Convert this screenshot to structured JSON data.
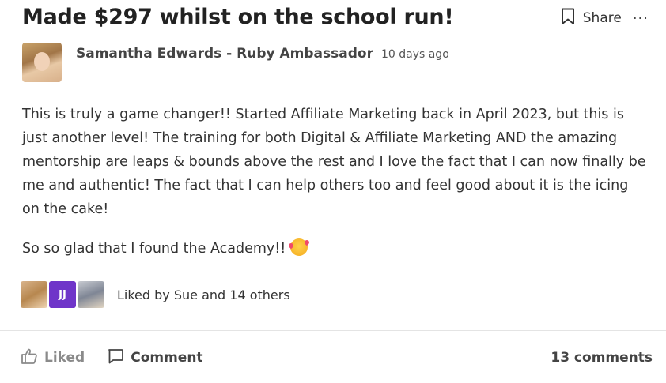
{
  "post": {
    "title": "Made $297 whilst on the school run!",
    "author": "Samantha Edwards - Ruby Ambassador",
    "time": "10 days ago",
    "paragraphs": [
      "This is truly a game changer!! Started Affiliate Marketing back in April 2023, but this is just another level! The training for both Digital & Affiliate Marketing AND the amazing mentorship are leaps & bounds above the rest and I love the fact that I can now finally be me and authentic! The fact that I can help others too and feel good about it is the icing on the cake!",
      " So so glad that I found the Academy!!"
    ],
    "emoji": "smiling-face-with-hearts"
  },
  "header_actions": {
    "share_label": "Share",
    "more_label": "···"
  },
  "likes": {
    "avatar_initials": "JJ",
    "text": "Liked by Sue and 14 others"
  },
  "footer": {
    "liked_label": "Liked",
    "comment_label": "Comment",
    "comments_count": "13 comments"
  },
  "colors": {
    "accent_avatar": "#6f35c9",
    "liked_gray": "#8a8a8a"
  }
}
